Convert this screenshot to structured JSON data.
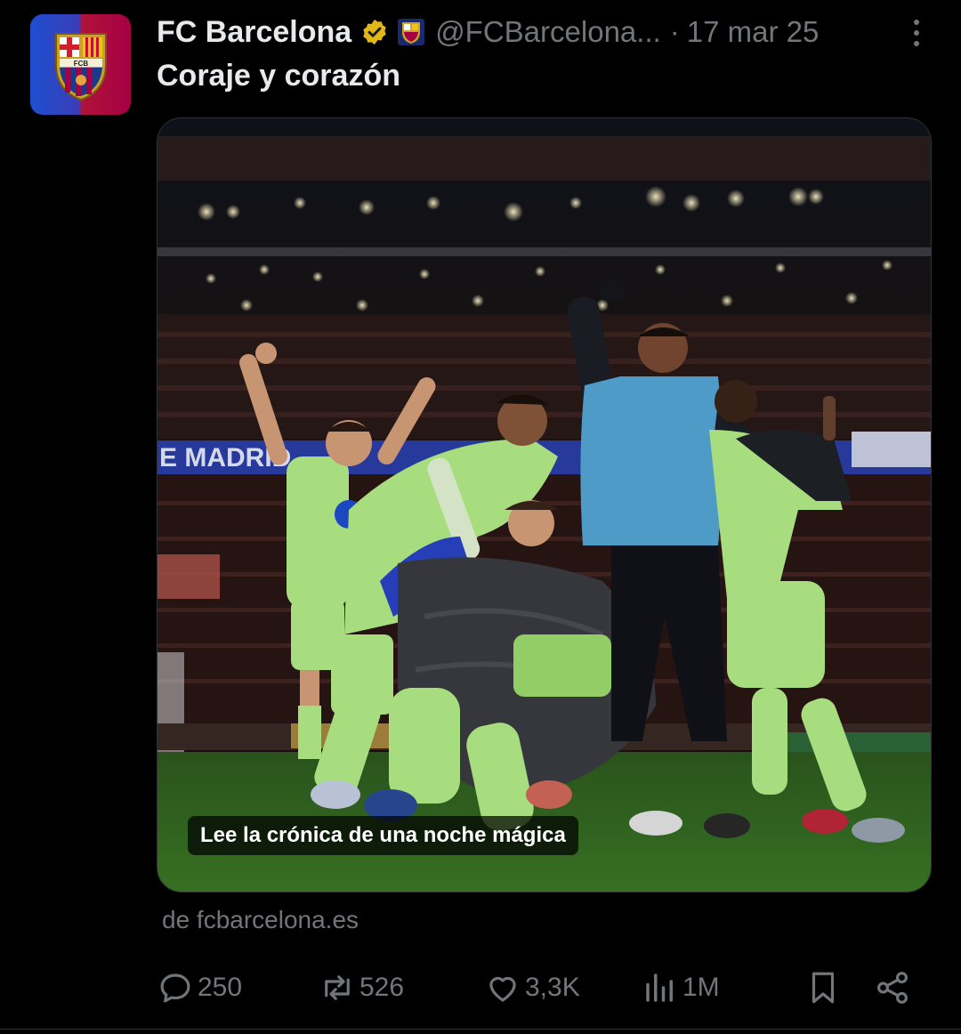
{
  "tweet": {
    "author_name": "FC Barcelona",
    "handle": "@FCBarcelona...",
    "separator": "·",
    "timestamp": "17 mar 25",
    "text": "Coraje y corazón",
    "avatar_label": "FCB"
  },
  "card": {
    "title": "Lee la crónica de una noche mágica",
    "stadium_banner": "E MADRID",
    "source": "de fcbarcelona.es"
  },
  "actions": {
    "replies": "250",
    "reposts": "526",
    "likes": "3,3K",
    "views": "1M"
  },
  "colors": {
    "background": "#000000",
    "text_primary": "#e7e9ea",
    "text_secondary": "#71767b",
    "verified_gold": "#e2b719",
    "kit_green": "#b6f08a"
  },
  "icons": [
    "fcb-crest-icon",
    "verified-badge-icon",
    "club-badge-icon",
    "more-icon",
    "reply-icon",
    "repost-icon",
    "like-icon",
    "views-icon",
    "bookmark-icon",
    "share-icon"
  ]
}
